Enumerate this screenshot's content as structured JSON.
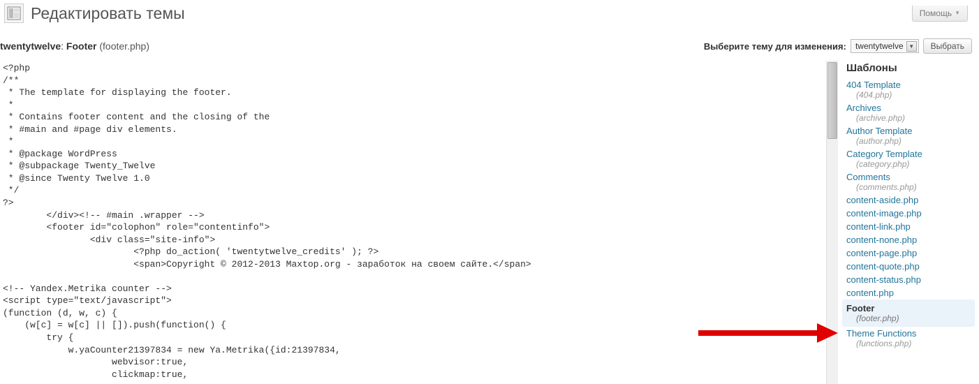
{
  "page_title": "Редактировать темы",
  "help_label": "Помощь",
  "file_heading": {
    "theme": "twentytwelve",
    "section": "Footer",
    "filename": "(footer.php)"
  },
  "theme_picker": {
    "label": "Выберите тему для изменения:",
    "selected": "twentytwelve",
    "button": "Выбрать"
  },
  "code": "<?php\n/**\n * The template for displaying the footer.\n *\n * Contains footer content and the closing of the\n * #main and #page div elements.\n *\n * @package WordPress\n * @subpackage Twenty_Twelve\n * @since Twenty Twelve 1.0\n */\n?>\n        </div><!-- #main .wrapper -->\n        <footer id=\"colophon\" role=\"contentinfo\">\n                <div class=\"site-info\">\n                        <?php do_action( 'twentytwelve_credits' ); ?>\n                        <span>Copyright © 2012-2013 Maxtop.org - заработок на своем сайте.</span>\n\n<!-- Yandex.Metrika counter -->\n<script type=\"text/javascript\">\n(function (d, w, c) {\n    (w[c] = w[c] || []).push(function() {\n        try {\n            w.yaCounter21397834 = new Ya.Metrika({id:21397834,\n                    webvisor:true,\n                    clickmap:true,\n                    trackLinks:true,",
  "sidebar": {
    "heading": "Шаблоны",
    "items": [
      {
        "label": "404 Template",
        "file": "(404.php)",
        "active": false
      },
      {
        "label": "Archives",
        "file": "(archive.php)",
        "active": false
      },
      {
        "label": "Author Template",
        "file": "(author.php)",
        "active": false
      },
      {
        "label": "Category Template",
        "file": "(category.php)",
        "active": false
      },
      {
        "label": "Comments",
        "file": "(comments.php)",
        "active": false
      },
      {
        "label": "content-aside.php",
        "file": "",
        "active": false
      },
      {
        "label": "content-image.php",
        "file": "",
        "active": false
      },
      {
        "label": "content-link.php",
        "file": "",
        "active": false
      },
      {
        "label": "content-none.php",
        "file": "",
        "active": false
      },
      {
        "label": "content-page.php",
        "file": "",
        "active": false
      },
      {
        "label": "content-quote.php",
        "file": "",
        "active": false
      },
      {
        "label": "content-status.php",
        "file": "",
        "active": false
      },
      {
        "label": "content.php",
        "file": "",
        "active": false
      },
      {
        "label": "Footer",
        "file": "(footer.php)",
        "active": true
      },
      {
        "label": "Theme Functions",
        "file": "(functions.php)",
        "active": false
      }
    ]
  }
}
